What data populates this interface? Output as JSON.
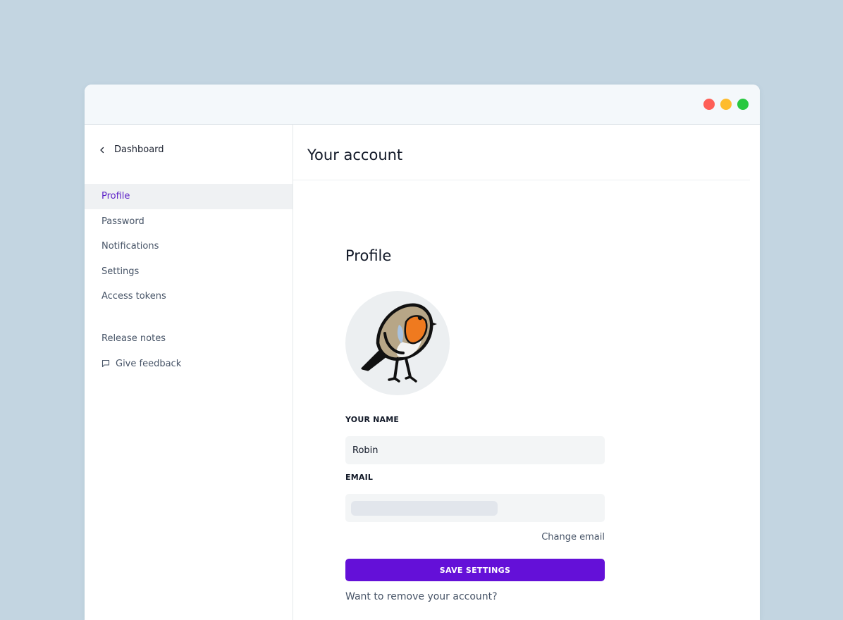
{
  "colors": {
    "background": "#c3d5e1",
    "accent": "#6410d8",
    "active_nav_text": "#5b1fc7",
    "traffic_red": "#fe5f57",
    "traffic_yellow": "#febc2e",
    "traffic_green": "#28c840"
  },
  "window": {
    "controls": [
      "close",
      "minimize",
      "maximize"
    ]
  },
  "sidebar": {
    "back_label": "Dashboard",
    "back_icon": "chevron-left-icon",
    "items": [
      {
        "label": "Profile",
        "active": true
      },
      {
        "label": "Password",
        "active": false
      },
      {
        "label": "Notifications",
        "active": false
      },
      {
        "label": "Settings",
        "active": false
      },
      {
        "label": "Access tokens",
        "active": false
      }
    ],
    "secondary": [
      {
        "label": "Release notes",
        "icon": ""
      },
      {
        "label": "Give feedback",
        "icon": "comment-icon"
      }
    ]
  },
  "main": {
    "page_title": "Your account",
    "section_title": "Profile",
    "avatar_icon": "robin-bird-icon",
    "name_label": "YOUR NAME",
    "name_value": "Robin",
    "email_label": "EMAIL",
    "email_value": "",
    "change_email": "Change email",
    "save_button": "SAVE SETTINGS",
    "remove_account": "Want to remove your account?"
  }
}
